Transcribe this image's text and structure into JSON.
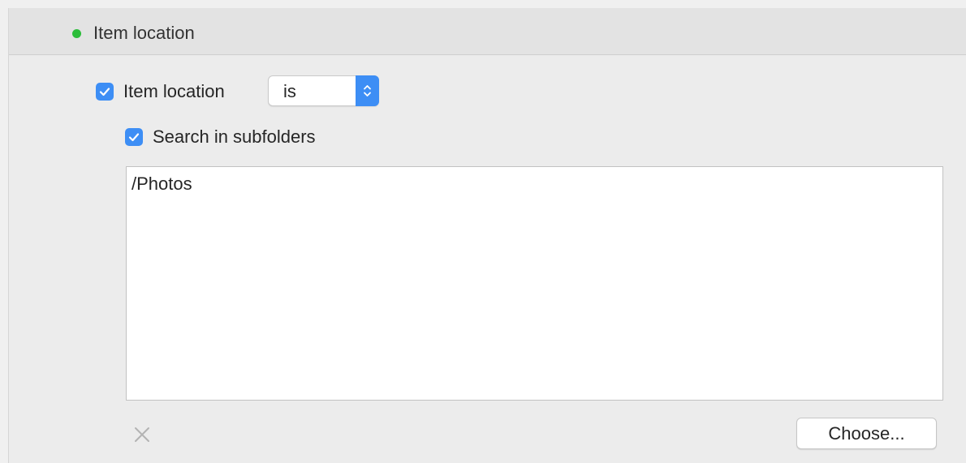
{
  "colors": {
    "status_dot": "#2cbd3a",
    "checkbox_accent": "#3d8ef5",
    "stepper_accent": "#3d8ef5",
    "remove_icon": "#b3b3b3"
  },
  "header": {
    "title": "Item location",
    "status_icon": "green-dot-icon"
  },
  "condition": {
    "checked": true,
    "label": "Item location",
    "operator": {
      "selected": "is",
      "icon": "up-down-chevron-icon"
    }
  },
  "subfolders": {
    "checked": true,
    "label": "Search in subfolders"
  },
  "paths": [
    "/Photos"
  ],
  "footer": {
    "remove_icon": "close-x-icon",
    "choose_label": "Choose..."
  }
}
